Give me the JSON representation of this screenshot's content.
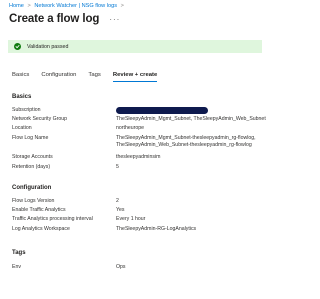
{
  "breadcrumb": {
    "home": "Home",
    "sep1": ">",
    "parent": "Network Watcher | NSG flow logs",
    "sep2": ">"
  },
  "header": {
    "title": "Create a flow log",
    "more": "···"
  },
  "validation": {
    "text": "Validation passed",
    "icon": "check-circle-icon",
    "color": "#107c10"
  },
  "tabs": [
    "Basics",
    "Configuration",
    "Tags",
    "Review + create"
  ],
  "active_tab": "Review + create",
  "basics": {
    "title": "Basics",
    "subscription_label": "Subscription",
    "nsg_label": "Network Security Group",
    "nsg_value": "TheSleepyAdmin_Mgmt_Subnet, TheSleepyAdmin_Web_Subnet",
    "location_label": "Location",
    "location_value": "northeurope",
    "flowlog_label": "Flow Log Name",
    "flowlog_value_1": "TheSleepyAdmin_Mgmt_Subnet-thesleepyadmin_rg-flowlog,",
    "flowlog_value_2": "TheSleepyAdmin_Web_Subnet-thesleepyadmin_rg-flowlog",
    "storage_label": "Storage Accounts",
    "storage_value": "thesleepyadminsim",
    "retention_label": "Retention (days)",
    "retention_value": "5"
  },
  "configuration": {
    "title": "Configuration",
    "version_label": "Flow Logs Version",
    "version_value": "2",
    "analytics_label": "Enable Traffic Analytics",
    "analytics_value": "Yes",
    "interval_label": "Traffic Analytics processing interval",
    "interval_value": "Every 1 hour",
    "workspace_label": "Log Analytics Workspace",
    "workspace_value": "TheSleepyAdmin-RG-LogAnalytics"
  },
  "tags": {
    "title": "Tags",
    "env_label": "Env",
    "env_value": "Ops"
  }
}
